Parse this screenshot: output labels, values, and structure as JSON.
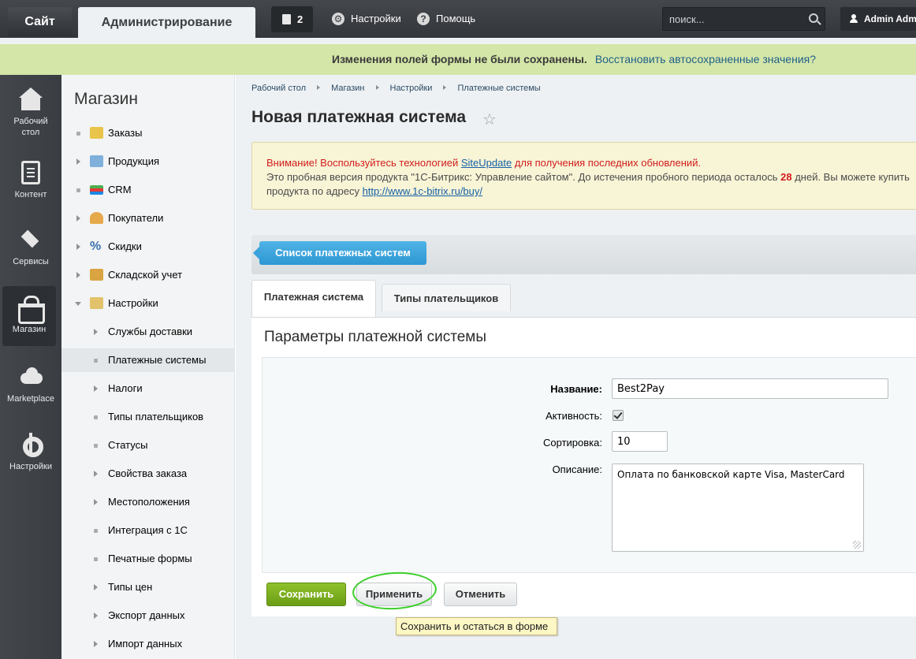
{
  "topbar": {
    "site_tab": "Сайт",
    "admin_tab": "Администрирование",
    "notifications_count": "2",
    "settings_label": "Настройки",
    "help_label": "Помощь",
    "search_placeholder": "поиск...",
    "user_name": "Admin Adm"
  },
  "notice": {
    "message": "Изменения полей формы не были сохранены.",
    "restore_link": "Восстановить автосохраненные значения?"
  },
  "leftmenu": {
    "items": [
      {
        "label_line1": "Рабочий",
        "label_line2": "стол",
        "icon": "home-icon"
      },
      {
        "label_line1": "Контент",
        "label_line2": "",
        "icon": "document-icon"
      },
      {
        "label_line1": "Сервисы",
        "label_line2": "",
        "icon": "layers-icon"
      },
      {
        "label_line1": "Магазин",
        "label_line2": "",
        "icon": "basket-icon"
      },
      {
        "label_line1": "Marketplace",
        "label_line2": "",
        "icon": "cloud-icon"
      },
      {
        "label_line1": "Настройки",
        "label_line2": "",
        "icon": "gear-icon"
      }
    ]
  },
  "sidebar": {
    "title": "Магазин",
    "items": [
      {
        "label": "Заказы"
      },
      {
        "label": "Продукция"
      },
      {
        "label": "CRM"
      },
      {
        "label": "Покупатели"
      },
      {
        "label": "Скидки"
      },
      {
        "label": "Складской учет"
      },
      {
        "label": "Настройки"
      },
      {
        "label": "Службы доставки"
      },
      {
        "label": "Платежные системы"
      },
      {
        "label": "Налоги"
      },
      {
        "label": "Типы плательщиков"
      },
      {
        "label": "Статусы"
      },
      {
        "label": "Свойства заказа"
      },
      {
        "label": "Местоположения"
      },
      {
        "label": "Интеграция с 1С"
      },
      {
        "label": "Печатные формы"
      },
      {
        "label": "Типы цен"
      },
      {
        "label": "Экспорт данных"
      },
      {
        "label": "Импорт данных"
      }
    ]
  },
  "breadcrumb": [
    "Рабочий стол",
    "Магазин",
    "Настройки",
    "Платежные системы"
  ],
  "page_title": "Новая платежная система",
  "warning": {
    "attention": "Внимание! Воспользуйтесь технологией ",
    "siteupdate_link": "SiteUpdate",
    "attention_tail": " для получения последних обновлений.",
    "trial_text": "Это пробная версия продукта \"1С-Битрикс: Управление сайтом\". До истечения пробного периода осталось ",
    "days": "28",
    "trial_tail": " дней. Вы можете купить",
    "line3": "продукта по адресу ",
    "buy_link": "http://www.1c-bitrix.ru/buy/"
  },
  "toolbar": {
    "list_button": "Список платежных систем"
  },
  "tabs": [
    {
      "label": "Платежная система",
      "active": true
    },
    {
      "label": "Типы плательщиков",
      "active": false
    }
  ],
  "form": {
    "section_title": "Параметры платежной системы",
    "name_label": "Название:",
    "name_value": "Best2Pay",
    "active_label": "Активность:",
    "active_checked": true,
    "sort_label": "Сортировка:",
    "sort_value": "10",
    "description_label": "Описание:",
    "description_value": "Оплата по банковской карте Visa, MasterCard"
  },
  "buttons": {
    "save": "Сохранить",
    "apply": "Применить",
    "cancel": "Отменить"
  },
  "tooltip": "Сохранить и остаться в форме",
  "colors": {
    "notice_bg": "#d4e6a8",
    "save_green": "#7aae1d",
    "list_blue": "#3aa3db",
    "highlight_circle": "#3ccf2a"
  }
}
